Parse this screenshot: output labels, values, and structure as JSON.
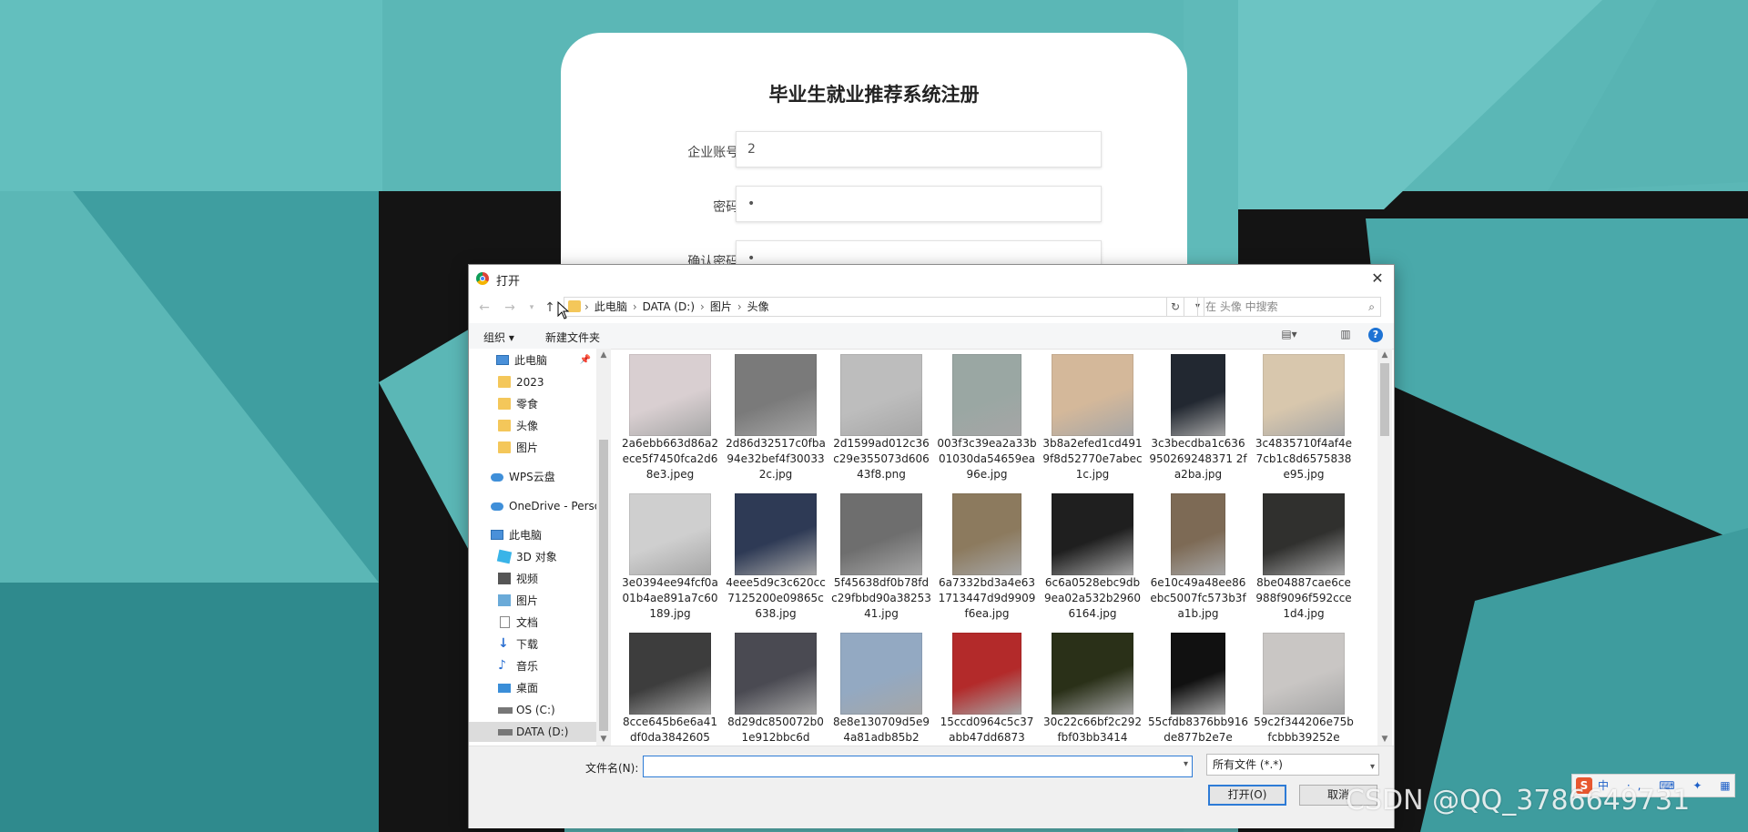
{
  "registration": {
    "title": "毕业生就业推荐系统注册",
    "fields": [
      {
        "label": "企业账号:",
        "value": "2"
      },
      {
        "label": "密码:",
        "value": "•"
      },
      {
        "label": "确认密码:",
        "value": "•"
      }
    ]
  },
  "dialog": {
    "title": "打开",
    "close_glyph": "✕",
    "nav_icons": {
      "back": "back-arrow-icon",
      "forward": "forward-arrow-icon",
      "recent": "recent-chevron-icon",
      "up": "up-arrow-icon"
    },
    "breadcrumbs": [
      "此电脑",
      "DATA (D:)",
      "图片",
      "头像"
    ],
    "search_placeholder": "在 头像 中搜索",
    "toolbar": {
      "organize": "组织 ▾",
      "new_folder": "新建文件夹"
    },
    "nav_pane": [
      {
        "label": "此电脑",
        "icon": "pc-icon",
        "pinned": true
      },
      {
        "label": "2023",
        "icon": "folder-icon"
      },
      {
        "label": "零食",
        "icon": "folder-icon"
      },
      {
        "label": "头像",
        "icon": "folder-icon"
      },
      {
        "label": "图片",
        "icon": "folder-icon"
      },
      {
        "label": "WPS云盘",
        "icon": "cloud-icon"
      },
      {
        "label": "OneDrive - Perso",
        "icon": "onedrive-icon"
      },
      {
        "label": "此电脑",
        "icon": "pc-icon"
      },
      {
        "label": "3D 对象",
        "icon": "3d-objects-icon"
      },
      {
        "label": "视频",
        "icon": "video-icon"
      },
      {
        "label": "图片",
        "icon": "pictures-icon"
      },
      {
        "label": "文档",
        "icon": "documents-icon"
      },
      {
        "label": "下载",
        "icon": "downloads-icon"
      },
      {
        "label": "音乐",
        "icon": "music-icon"
      },
      {
        "label": "桌面",
        "icon": "desktop-icon"
      },
      {
        "label": "OS (C:)",
        "icon": "drive-icon"
      },
      {
        "label": "DATA (D:)",
        "icon": "drive-icon",
        "selected": true
      }
    ],
    "files": [
      {
        "name": "2a6ebb663d86a2ece5f7450fca2d68e3.jpeg",
        "thumb": "#d9cfd1"
      },
      {
        "name": "2d86d32517c0fba94e32bef4f300332c.jpg",
        "thumb": "#7a7a7a"
      },
      {
        "name": "2d1599ad012c36c29e355073d60643f8.png",
        "thumb": "#bdbdbd"
      },
      {
        "name": "003f3c39ea2a33b01030da54659ea96e.jpg",
        "thumb": "#9aa7a3"
      },
      {
        "name": "3b8a2efed1cd4919f8d52770e7abec1c.jpg",
        "thumb": "#d4b89a"
      },
      {
        "name": "3c3becdba1c636950269248371 2fa2ba.jpg",
        "thumb": "#222831"
      },
      {
        "name": "3c4835710f4af4e7cb1c8d6575838e95.jpg",
        "thumb": "#d8c7ad"
      },
      {
        "name": "3e0394ee94fcf0a01b4ae891a7c60189.jpg",
        "thumb": "#cfcfcf"
      },
      {
        "name": "4eee5d9c3c620cc7125200e09865c638.jpg",
        "thumb": "#2e3a55"
      },
      {
        "name": "5f45638df0b78fdc29fbbd90a3825341.jpg",
        "thumb": "#6e6e6e"
      },
      {
        "name": "6a7332bd3a4e631713447d9d9909f6ea.jpg",
        "thumb": "#8c7a5e"
      },
      {
        "name": "6c6a0528ebc9db9ea02a532b29606164.jpg",
        "thumb": "#1f1f1f"
      },
      {
        "name": "6e10c49a48ee86ebc5007fc573b3fa1b.jpg",
        "thumb": "#7d6a55"
      },
      {
        "name": "8be04887cae6ce988f9096f592cce1d4.jpg",
        "thumb": "#30302e"
      },
      {
        "name": "8cce645b6e6a41df0da3842605",
        "thumb": "#3d3d3d"
      },
      {
        "name": "8d29dc850072b01e912bbc6d",
        "thumb": "#4a4a52"
      },
      {
        "name": "8e8e130709d5e94a81adb85b2",
        "thumb": "#93a9c2"
      },
      {
        "name": "15ccd0964c5c37abb47dd6873",
        "thumb": "#b32a2a"
      },
      {
        "name": "30c22c66bf2c292fbf03bb3414",
        "thumb": "#2a3018"
      },
      {
        "name": "55cfdb8376bb916de877b2e7e",
        "thumb": "#111111"
      },
      {
        "name": "59c2f344206e75bfcbbb39252e",
        "thumb": "#c9c6c4"
      }
    ],
    "bottom": {
      "filename_label": "文件名(N):",
      "filename_value": "",
      "filetype": "所有文件 (*.*)",
      "open_button": "打开(O)",
      "cancel_button": "取消"
    }
  },
  "watermark": "CSDN @QQ_3786649731",
  "ime": {
    "logo": "S",
    "icons": "中 ·, ⌨ ✦ ▦"
  },
  "colors": {
    "teal": "#5bb7b6",
    "dark": "#121212",
    "accent": "#2d7bd6"
  }
}
